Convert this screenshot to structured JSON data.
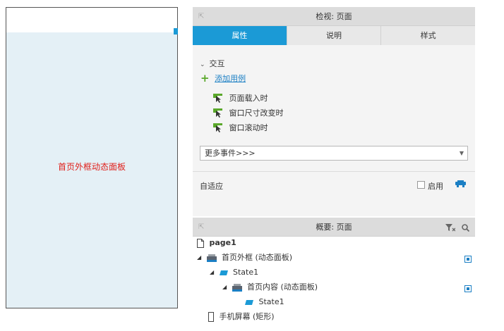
{
  "canvas": {
    "dynamic_panel_label": "首页外框动态面板"
  },
  "inspector": {
    "title": "检视: 页面",
    "tabs": [
      "属性",
      "说明",
      "样式"
    ],
    "interaction_section": "交互",
    "add_case": "添加用例",
    "events": [
      "页面载入时",
      "窗口尺寸改变时",
      "窗口滚动时"
    ],
    "more_events": "更多事件>>>",
    "adaptive_label": "自适应",
    "enable_label": "启用"
  },
  "outline": {
    "title": "概要: 页面",
    "page_name": "page1",
    "items": [
      "首页外框 (动态面板)",
      "State1",
      "首页内容 (动态面板)",
      "State1",
      "手机屏幕 (矩形)"
    ]
  },
  "colors": {
    "accent": "#1b9ad6",
    "panel_fill": "#e4f0f6",
    "panel_text": "#e0201b",
    "event_icon": "#5aa82a"
  }
}
